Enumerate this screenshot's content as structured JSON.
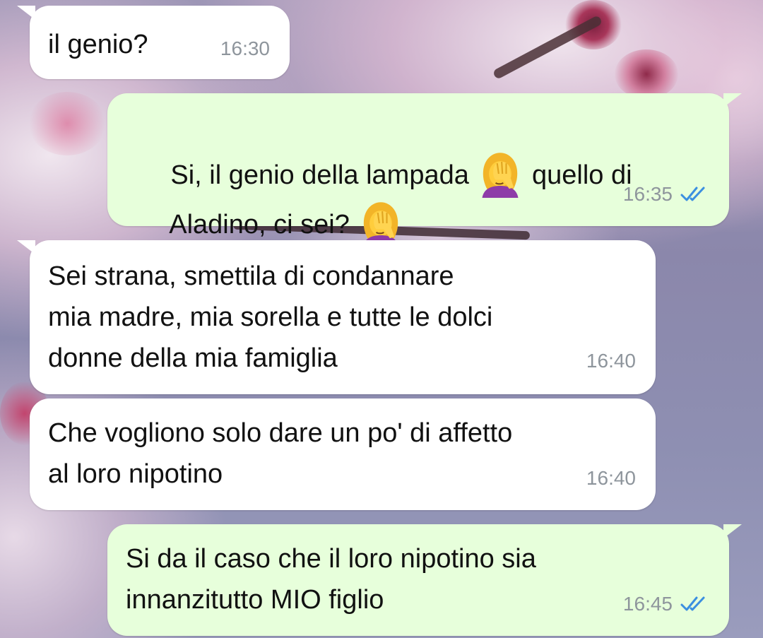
{
  "theme": {
    "incoming_bg": "#ffffff",
    "outgoing_bg": "#e7ffdb",
    "read_tick_color": "#3b8fe0",
    "timestamp_color": "#8e959c"
  },
  "messages": [
    {
      "direction": "incoming",
      "lines": [
        "il genio?"
      ],
      "time": "16:30"
    },
    {
      "direction": "outgoing",
      "segments": {
        "line1_before": "Si, il genio della lampada ",
        "line1_emoji": "woman-facepalming",
        "line1_after": " quello di",
        "line2_before": "Aladino, ci sei? ",
        "line2_emoji": "woman-facepalming"
      },
      "time": "16:35",
      "status": "read"
    },
    {
      "direction": "incoming",
      "lines": [
        "Sei strana, smettila di condannare",
        "mia madre, mia sorella e tutte le dolci",
        "donne della mia famiglia"
      ],
      "time": "16:40"
    },
    {
      "direction": "incoming",
      "lines": [
        "Che vogliono solo dare un po' di affetto",
        "al loro nipotino"
      ],
      "time": "16:40"
    },
    {
      "direction": "outgoing",
      "lines": [
        "Si da il caso che il loro nipotino sia",
        "innanzitutto MIO figlio"
      ],
      "time": "16:45",
      "status": "read"
    }
  ]
}
